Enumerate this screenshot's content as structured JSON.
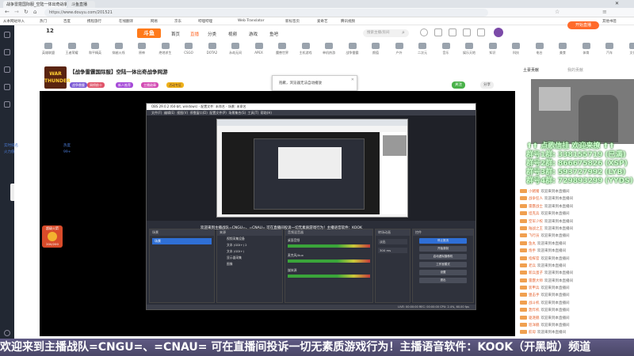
{
  "browser": {
    "tabs": [
      {
        "label": "战争雷霆国际服_空陆一体出奇战争网游"
      },
      {
        "label": "斗鱼直播"
      }
    ],
    "url": "https://www.douyu.com/201521",
    "bookmarks": [
      "从本网站导入",
      "热门",
      "百度",
      "携程旅行",
      "在线翻译",
      "网易",
      "京东",
      "哔哩哔哩",
      "Web Translator",
      "新标签页",
      "爱奇艺",
      "腾讯视频",
      "其他书签"
    ]
  },
  "site": {
    "logo": "斗鱼",
    "nav": [
      "首页",
      "直播",
      "分类",
      "视频",
      "游戏",
      "鱼吧"
    ],
    "search_placeholder": "搜索主播/房间",
    "start_live": "开始直播",
    "level_number": "12",
    "categories": [
      "英雄联盟",
      "王者荣耀",
      "和平精英",
      "穿越火线",
      "原神",
      "绝地求生",
      "CSGO",
      "DOTA2",
      "永劫无间",
      "APEX",
      "魔兽世界",
      "主机游戏",
      "单机热游",
      "战争雷霆",
      "颜值",
      "户外",
      "二次元",
      "音乐",
      "娱乐天地",
      "知识",
      "科技",
      "电台",
      "美食",
      "体育",
      "汽车",
      "文化"
    ]
  },
  "stream": {
    "title": "【战争雷霆国际服】空陆一体出奇战争网游",
    "avatar_text": "WAR THUNDER",
    "tags": [
      "战争雷霆",
      "周榜前十",
      "新人推荐",
      "主播勋章",
      "活动专区"
    ],
    "follow_btn": "关注",
    "share_btn": "分享"
  },
  "notice": {
    "text": "抱歉，浏览器无法自动播放"
  },
  "player": {
    "subtitle": "欢迎来到主播战队=CNGU=、=CNAU= 可在直播间投诉一切无素质游戏行为！主播语音软件：KOOK",
    "left_stats": [
      "实时排名",
      "火力值",
      "热度",
      "99+"
    ]
  },
  "obs": {
    "title": "OBS 29.0.2 (64-bit, windows) - 配置文件: 未命名 - 场景: 未命名",
    "menu": [
      "文件(F)",
      "编辑(E)",
      "视图(V)",
      "停靠窗口(D)",
      "配置文件(P)",
      "场景集合(S)",
      "工具(T)",
      "帮助(H)"
    ],
    "scene_panel": "场景",
    "scene_item": "场景",
    "sources_panel": "来源",
    "sources": [
      "视频采集设备",
      "文本 (GDI+) 2",
      "文本 (GDI+)",
      "显示器采集",
      "图像"
    ],
    "mixer_panel": "音频混音器",
    "mixer_channels": [
      "桌面音频",
      "麦克风/Aux",
      "媒体源"
    ],
    "transition_panel": "转场动画",
    "transition_type": "淡出",
    "transition_duration": "300 ms",
    "controls_panel": "控件",
    "controls": [
      "停止推流",
      "开始录制",
      "启动虚拟摄像机",
      "工作室模式",
      "设置",
      "退出"
    ],
    "status": "LIVE: 00:00:00   REC: 00:00:00   CPU: 2.4%, 60.00 fps"
  },
  "gift": {
    "label": "超级火箭",
    "count": "200/200"
  },
  "right_panel": {
    "tabs": [
      "土豪贡献",
      "我的贡献"
    ],
    "overlay_lines": [
      "⬆⬆ 点歌信挂 欢迎来撩 ⬆⬆",
      "群号1群: 338155719 (已满)",
      "群号2群: 866675826 (XSP)",
      "群号3群: 593727992 (LYB)",
      "群号4群: 729893299 (YYDS)"
    ],
    "chat": [
      {
        "nick": "小猪猪",
        "msg": "欢迎来到本直播间"
      },
      {
        "nick": "战争狂人",
        "msg": "欢迎来到本直播间"
      },
      {
        "nick": "雷霆战士",
        "msg": "欢迎来到本直播间"
      },
      {
        "nick": "坦克兵",
        "msg": "欢迎来到本直播间"
      },
      {
        "nick": "空军少校",
        "msg": "欢迎来到本直播间"
      },
      {
        "nick": "陆战之王",
        "msg": "欢迎来到本直播间"
      },
      {
        "nick": "飞行员",
        "msg": "欢迎来到本直播间"
      },
      {
        "nick": "鱼丸",
        "msg": "欢迎来到本直播间"
      },
      {
        "nick": "炮手",
        "msg": "欢迎来到本直播间"
      },
      {
        "nick": "指挥官",
        "msg": "欢迎来到本直播间"
      },
      {
        "nick": "老兵",
        "msg": "欢迎来到本直播间"
      },
      {
        "nick": "新兵蛋子",
        "msg": "欢迎来到本直播间"
      },
      {
        "nick": "雷霆大师",
        "msg": "欢迎来到本直播间"
      },
      {
        "nick": "装甲兵",
        "msg": "欢迎来到本直播间"
      },
      {
        "nick": "狙击手",
        "msg": "欢迎来到本直播间"
      },
      {
        "nick": "战斗机",
        "msg": "欢迎来到本直播间"
      },
      {
        "nick": "轰炸机",
        "msg": "欢迎来到本直播间"
      },
      {
        "nick": "驱逐舰",
        "msg": "欢迎来到本直播间"
      },
      {
        "nick": "巡洋舰",
        "msg": "欢迎来到本直播间"
      },
      {
        "nick": "航母",
        "msg": "欢迎来到本直播间"
      }
    ]
  },
  "ticker": "欢迎来到主播战队=CNGU=、=CNAU= 可在直播间投诉一切无素质游戏行为！主播语音软件：KOOK（开黑啦）频道"
}
